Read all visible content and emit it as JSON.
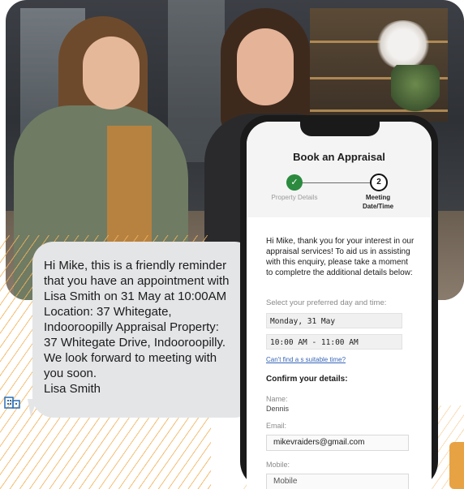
{
  "sms": {
    "lines": [
      "Hi Mike, this is a friendly reminder",
      "that you have an appointment with",
      "Lisa Smith on 31 May at 10:00AM",
      "Location: 37 Whitegate,",
      "Indooroopilly Appraisal Property:",
      "37 Whitegate Drive, Indooroopilly.",
      "We look forward to meeting with",
      "you soon.",
      "Lisa Smith"
    ],
    "bubble_color": "#e4e5e7",
    "sender_icon": "building-icon"
  },
  "app": {
    "title": "Book an Appraisal",
    "steps": [
      {
        "number": "✓",
        "label": "Property Details",
        "state": "complete"
      },
      {
        "number": "2",
        "label": "Meeting Date/Time",
        "state": "current"
      }
    ],
    "intro": "Hi Mike, thank you for your interest in our appraisal services! To aid us in assisting with this enquiry, please take a moment to completre the additional details below:",
    "select_label": "Select your preferred day and time:",
    "day_value": "Monday, 31 May",
    "time_value": "10:00 AM - 11:00 AM",
    "alt_time_link": "Can't find a s suitable time?",
    "confirm_heading": "Confirm your details:",
    "name_label": "Name:",
    "name_value": "Dennis",
    "email_label": "Email:",
    "email_value": "mikevraiders@gmail.com",
    "mobile_label": "Mobile:",
    "mobile_value": "Mobile",
    "accent_color": "#2b8a3e"
  },
  "decor": {
    "line_color": "#f2b35b"
  }
}
